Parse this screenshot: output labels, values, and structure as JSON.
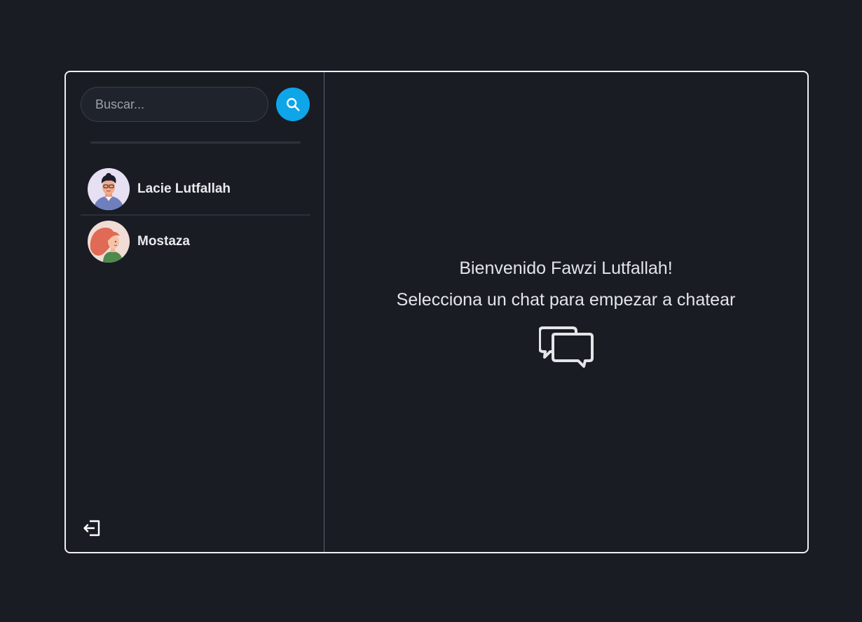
{
  "search": {
    "placeholder": "Buscar...",
    "button_icon": "search-icon"
  },
  "contacts": [
    {
      "name": "Lacie Lutfallah",
      "avatar": "male-avatar"
    },
    {
      "name": "Mostaza",
      "avatar": "female-avatar"
    }
  ],
  "logout": {
    "icon": "logout-icon"
  },
  "welcome": {
    "line1": "Bienvenido Fawzi Lutfallah!",
    "line2": "Selecciona un chat para empezar a chatear",
    "icon": "chat-bubbles-icon"
  },
  "colors": {
    "background": "#191c23",
    "accent": "#0ea5e9",
    "border": "#eef0f2",
    "text": "#e6e8ea"
  }
}
